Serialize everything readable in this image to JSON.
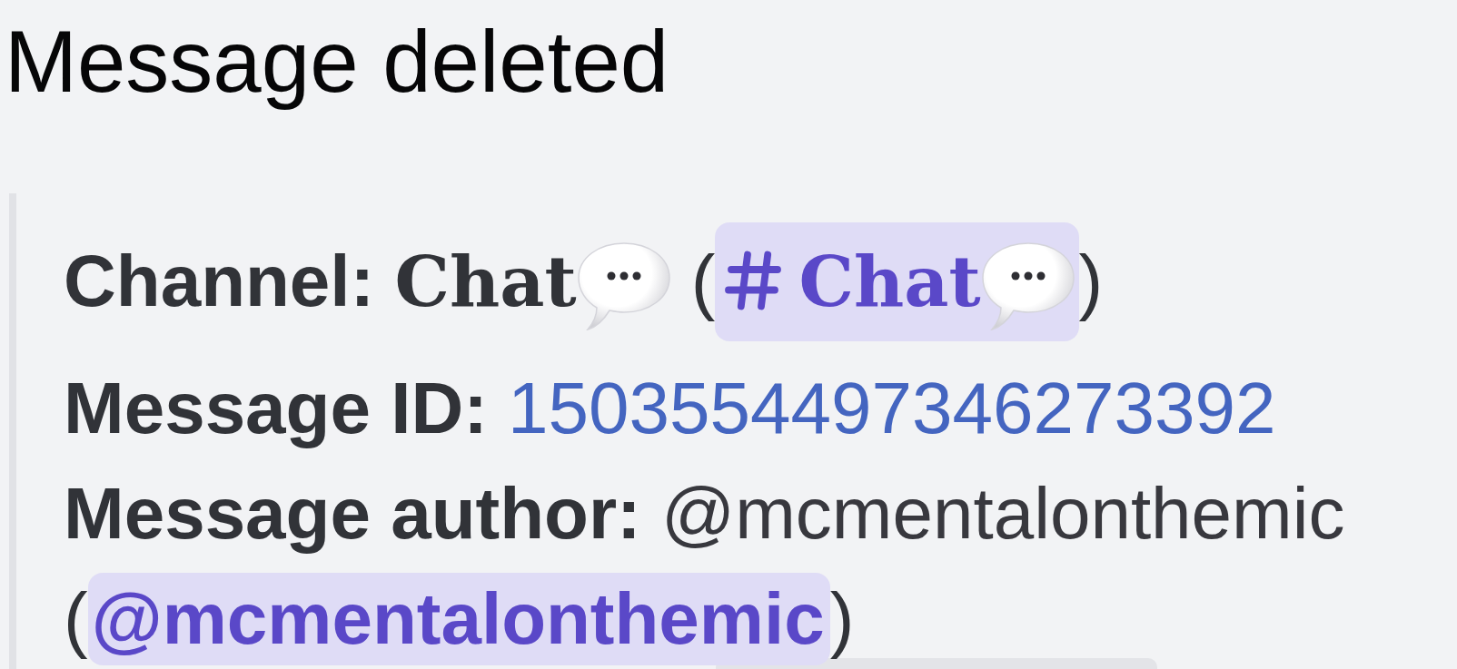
{
  "title": "Message deleted",
  "embed": {
    "fields": [
      {
        "kind": "channel",
        "label": "Channel:",
        "value": "Chat",
        "open": "(",
        "mention": {
          "kind": "channel",
          "text": "Chat"
        },
        "close": ")"
      },
      {
        "kind": "id",
        "label": "Message ID:",
        "value": "1503554497346273392"
      },
      {
        "kind": "user",
        "label": "Message author:",
        "value": "@mcmentalonthemic",
        "open": "(",
        "mention": {
          "kind": "user",
          "text": "@mcmentalonthemic"
        },
        "close": ")"
      }
    ]
  }
}
